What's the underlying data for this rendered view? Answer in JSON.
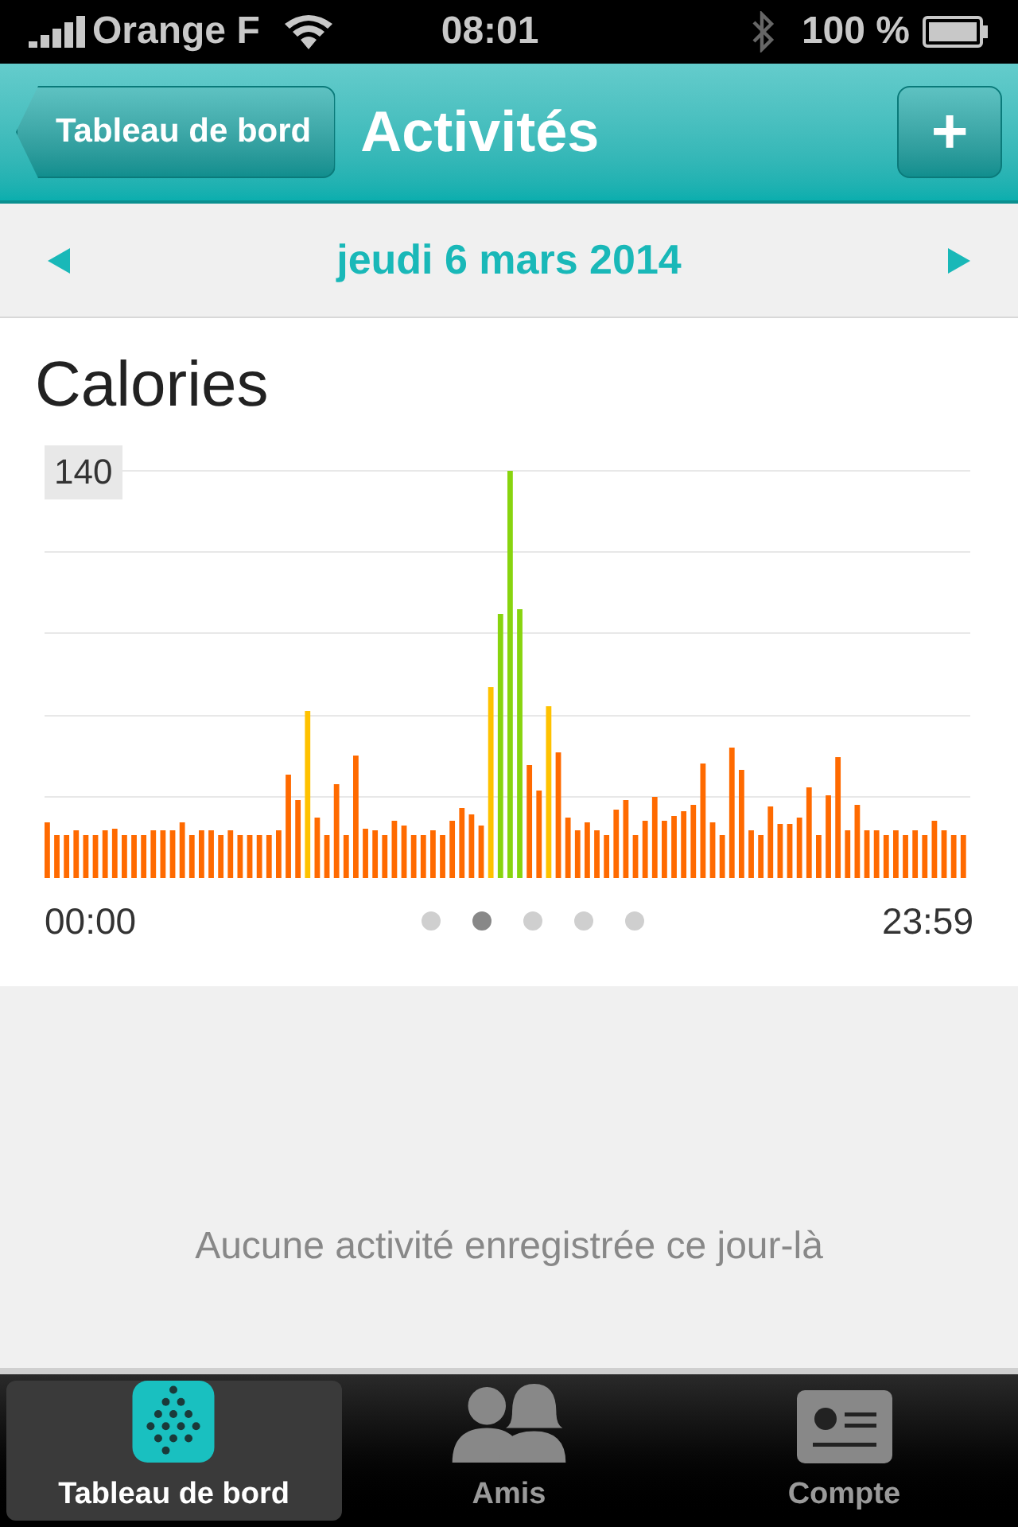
{
  "status_bar": {
    "carrier": "Orange F",
    "time": "08:01",
    "battery": "100 %"
  },
  "nav_bar": {
    "back": "Tableau de bord",
    "title": "Activités",
    "add": "+"
  },
  "date_bar": {
    "date": "jeudi 6 mars 2014"
  },
  "calories": {
    "title": "Calories",
    "max_label": "140",
    "start_time": "00:00",
    "end_time": "23:59"
  },
  "pages": [
    {
      "selected": false
    },
    {
      "selected": true
    },
    {
      "selected": false
    },
    {
      "selected": false
    },
    {
      "selected": false
    }
  ],
  "empty_message": "Aucune activité enregistrée ce jour-là",
  "tabs": [
    {
      "label": "Tableau de bord",
      "selected": true
    },
    {
      "label": "Amis",
      "selected": false
    },
    {
      "label": "Compte",
      "selected": false
    }
  ]
}
